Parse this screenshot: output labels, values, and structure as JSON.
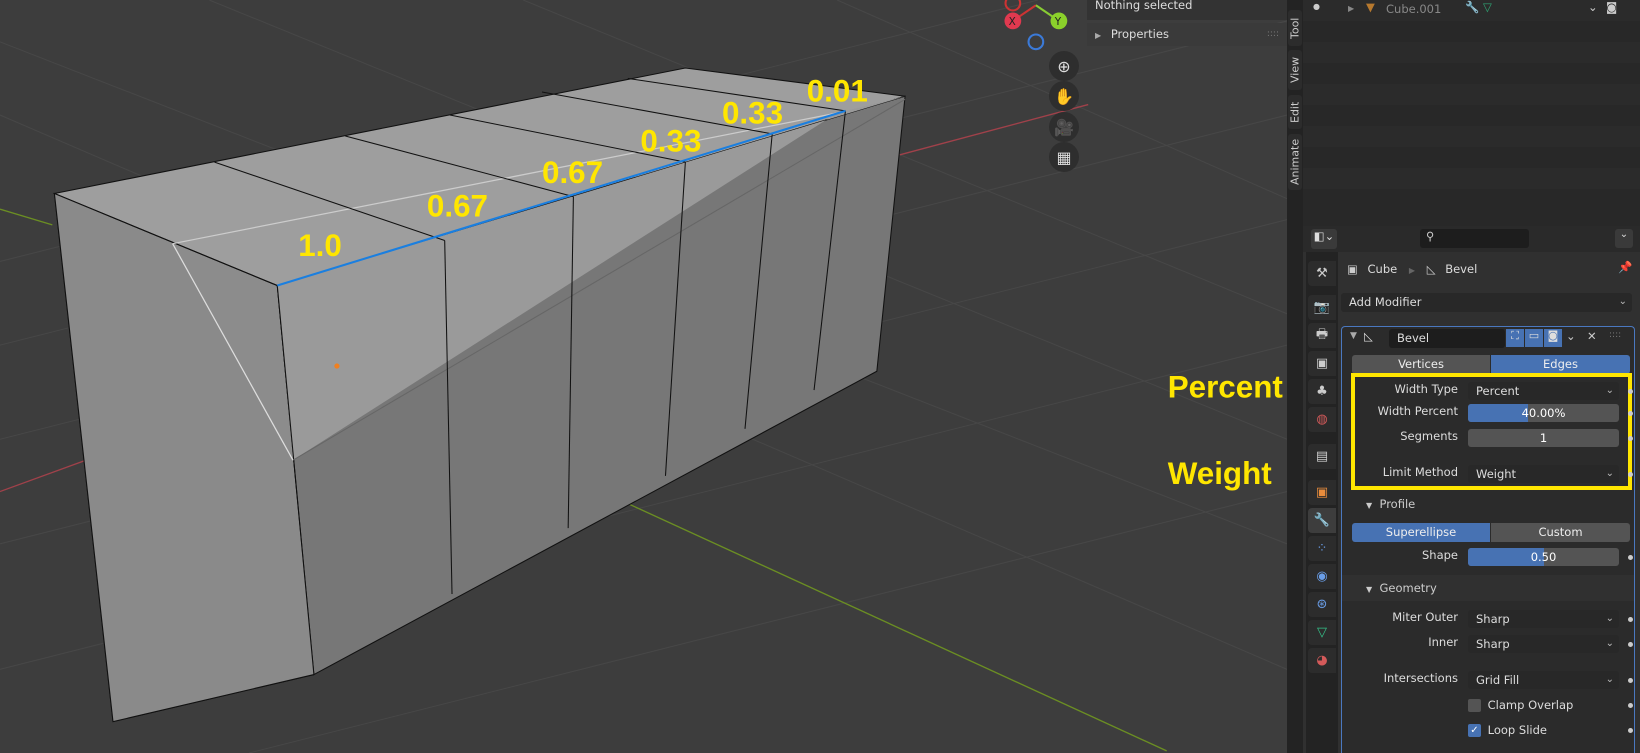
{
  "viewport": {
    "header_text": "Nothing selected",
    "properties_panel_label": "Properties",
    "gizmo": {
      "x": "X",
      "y": "Y"
    },
    "annotations": {
      "edge_weights": [
        "1.0",
        "0.67",
        "0.67",
        "0.33",
        "0.33",
        "0.01"
      ],
      "percent_label": "Percent",
      "weight_label": "Weight",
      "color": "#ffe600"
    },
    "nav_icons": [
      "zoom-icon",
      "hand-pan-icon",
      "camera-icon",
      "grid-perspective-icon"
    ]
  },
  "sidebar_tabs": [
    "Tool",
    "View",
    "Edit",
    "Animate"
  ],
  "outliner": {
    "item": "Cube.001"
  },
  "properties": {
    "breadcrumb": {
      "object": "Cube",
      "modifier": "Bevel"
    },
    "add_modifier": "Add Modifier",
    "modifier": {
      "name": "Bevel",
      "tabs": [
        "Vertices",
        "Edges"
      ],
      "active_tab": "Edges",
      "width_type": {
        "label": "Width Type",
        "value": "Percent"
      },
      "width_percent": {
        "label": "Width Percent",
        "value": "40.00%",
        "fraction": 0.4
      },
      "segments": {
        "label": "Segments",
        "value": "1"
      },
      "limit_method": {
        "label": "Limit Method",
        "value": "Weight"
      },
      "profile": {
        "title": "Profile",
        "types": [
          "Superellipse",
          "Custom"
        ],
        "active": "Superellipse",
        "shape": {
          "label": "Shape",
          "value": "0.50",
          "fraction": 0.5
        }
      },
      "geometry": {
        "title": "Geometry",
        "miter_outer": {
          "label": "Miter Outer",
          "value": "Sharp"
        },
        "inner": {
          "label": "Inner",
          "value": "Sharp"
        },
        "intersections": {
          "label": "Intersections",
          "value": "Grid Fill"
        },
        "clamp_overlap": {
          "label": "Clamp Overlap",
          "checked": false
        },
        "loop_slide": {
          "label": "Loop Slide",
          "checked": true
        }
      }
    }
  },
  "colors": {
    "accent": "#4772b3",
    "highlight": "#ffe600",
    "selected_edge": "#1a7fe0"
  }
}
